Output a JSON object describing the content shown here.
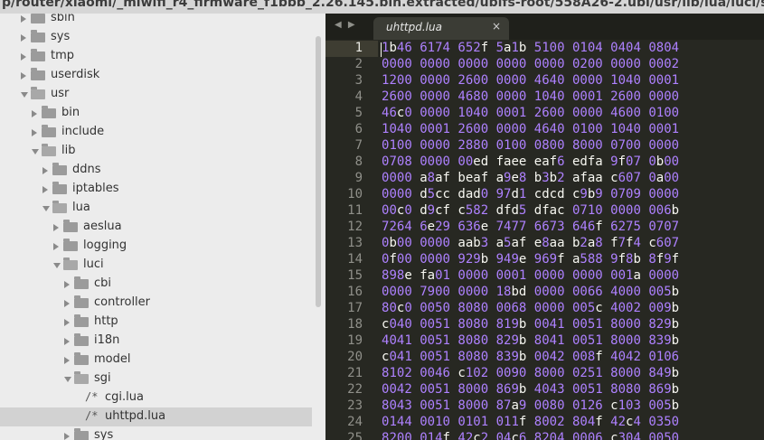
{
  "window": {
    "title_path": "p/router/xiaomi/_miwifi_r4_firmware_f1bbb_2.26.145.bin.extracted/ubifs-root/558A26-2.ubi/usr/lib/lua/luci/sgi/uhttpd.lua"
  },
  "sidebar": {
    "items": [
      {
        "label": "sbin",
        "depth": 2,
        "kind": "folder",
        "expanded": false
      },
      {
        "label": "sys",
        "depth": 2,
        "kind": "folder",
        "expanded": false
      },
      {
        "label": "tmp",
        "depth": 2,
        "kind": "folder",
        "expanded": false
      },
      {
        "label": "userdisk",
        "depth": 2,
        "kind": "folder",
        "expanded": false
      },
      {
        "label": "usr",
        "depth": 2,
        "kind": "folder",
        "expanded": true
      },
      {
        "label": "bin",
        "depth": 3,
        "kind": "folder",
        "expanded": false
      },
      {
        "label": "include",
        "depth": 3,
        "kind": "folder",
        "expanded": false
      },
      {
        "label": "lib",
        "depth": 3,
        "kind": "folder",
        "expanded": true
      },
      {
        "label": "ddns",
        "depth": 4,
        "kind": "folder",
        "expanded": false
      },
      {
        "label": "iptables",
        "depth": 4,
        "kind": "folder",
        "expanded": false
      },
      {
        "label": "lua",
        "depth": 4,
        "kind": "folder",
        "expanded": true
      },
      {
        "label": "aeslua",
        "depth": 5,
        "kind": "folder",
        "expanded": false
      },
      {
        "label": "logging",
        "depth": 5,
        "kind": "folder",
        "expanded": false
      },
      {
        "label": "luci",
        "depth": 5,
        "kind": "folder",
        "expanded": true
      },
      {
        "label": "cbi",
        "depth": 6,
        "kind": "folder",
        "expanded": false
      },
      {
        "label": "controller",
        "depth": 6,
        "kind": "folder",
        "expanded": false
      },
      {
        "label": "http",
        "depth": 6,
        "kind": "folder",
        "expanded": false
      },
      {
        "label": "i18n",
        "depth": 6,
        "kind": "folder",
        "expanded": false
      },
      {
        "label": "model",
        "depth": 6,
        "kind": "folder",
        "expanded": false
      },
      {
        "label": "sgi",
        "depth": 6,
        "kind": "folder",
        "expanded": true
      },
      {
        "label": "cgi.lua",
        "depth": 7,
        "kind": "file",
        "glyph": "/*"
      },
      {
        "label": "uhttpd.lua",
        "depth": 7,
        "kind": "file",
        "glyph": "/*",
        "selected": true
      },
      {
        "label": "sys",
        "depth": 6,
        "kind": "folder",
        "expanded": false
      }
    ]
  },
  "tabbar": {
    "nav_arrows": "◀ ▶",
    "active_tab": {
      "title": "uhttpd.lua",
      "close": "×"
    }
  },
  "editor": {
    "current_line": 1,
    "lines": [
      "1b46 6174 652f 5a1b 5100 0104 0404 0804",
      "0000 0000 0000 0000 0000 0200 0000 0002",
      "1200 0000 2600 0000 4640 0000 1040 0001",
      "2600 0000 4680 0000 1040 0001 2600 0000",
      "46c0 0000 1040 0001 2600 0000 4600 0100",
      "1040 0001 2600 0000 4640 0100 1040 0001",
      "0100 0000 2880 0100 0800 8000 0700 0000",
      "0708 0000 00ed faee eaf6 edfa 9f07 0b00",
      "0000 a8af beaf a9e8 b3b2 afaa c607 0a00",
      "0000 d5cc dad0 97d1 cdcd c9b9 0709 0000",
      "00c0 d9cf c582 dfd5 dfac 0710 0000 006b",
      "7264 6e29 636e 7477 6673 646f 6275 0707",
      "0b00 0000 aab3 a5af e8aa b2a8 f7f4 c607",
      "0f00 0000 929b 949e 969f a588 9f8b 8f9f",
      "898e fa01 0000 0001 0000 0000 001a 0000",
      "0000 7900 0000 18bd 0000 0066 4000 005b",
      "80c0 0050 8080 0068 0000 005c 4002 009b",
      "c040 0051 8080 819b 0041 0051 8000 829b",
      "4041 0051 8080 829b 8041 0051 8000 839b",
      "c041 0051 8080 839b 0042 008f 4042 0106",
      "8102 0046 c102 0090 8000 0251 8000 849b",
      "0042 0051 8000 869b 4043 0051 8080 869b",
      "8043 0051 8000 87a9 0080 0126 c103 005b",
      "0144 0010 0101 011f 8002 804f 42c4 0350",
      "8200 014f 42c2 04c6 8204 0006 c304 0050"
    ]
  }
}
